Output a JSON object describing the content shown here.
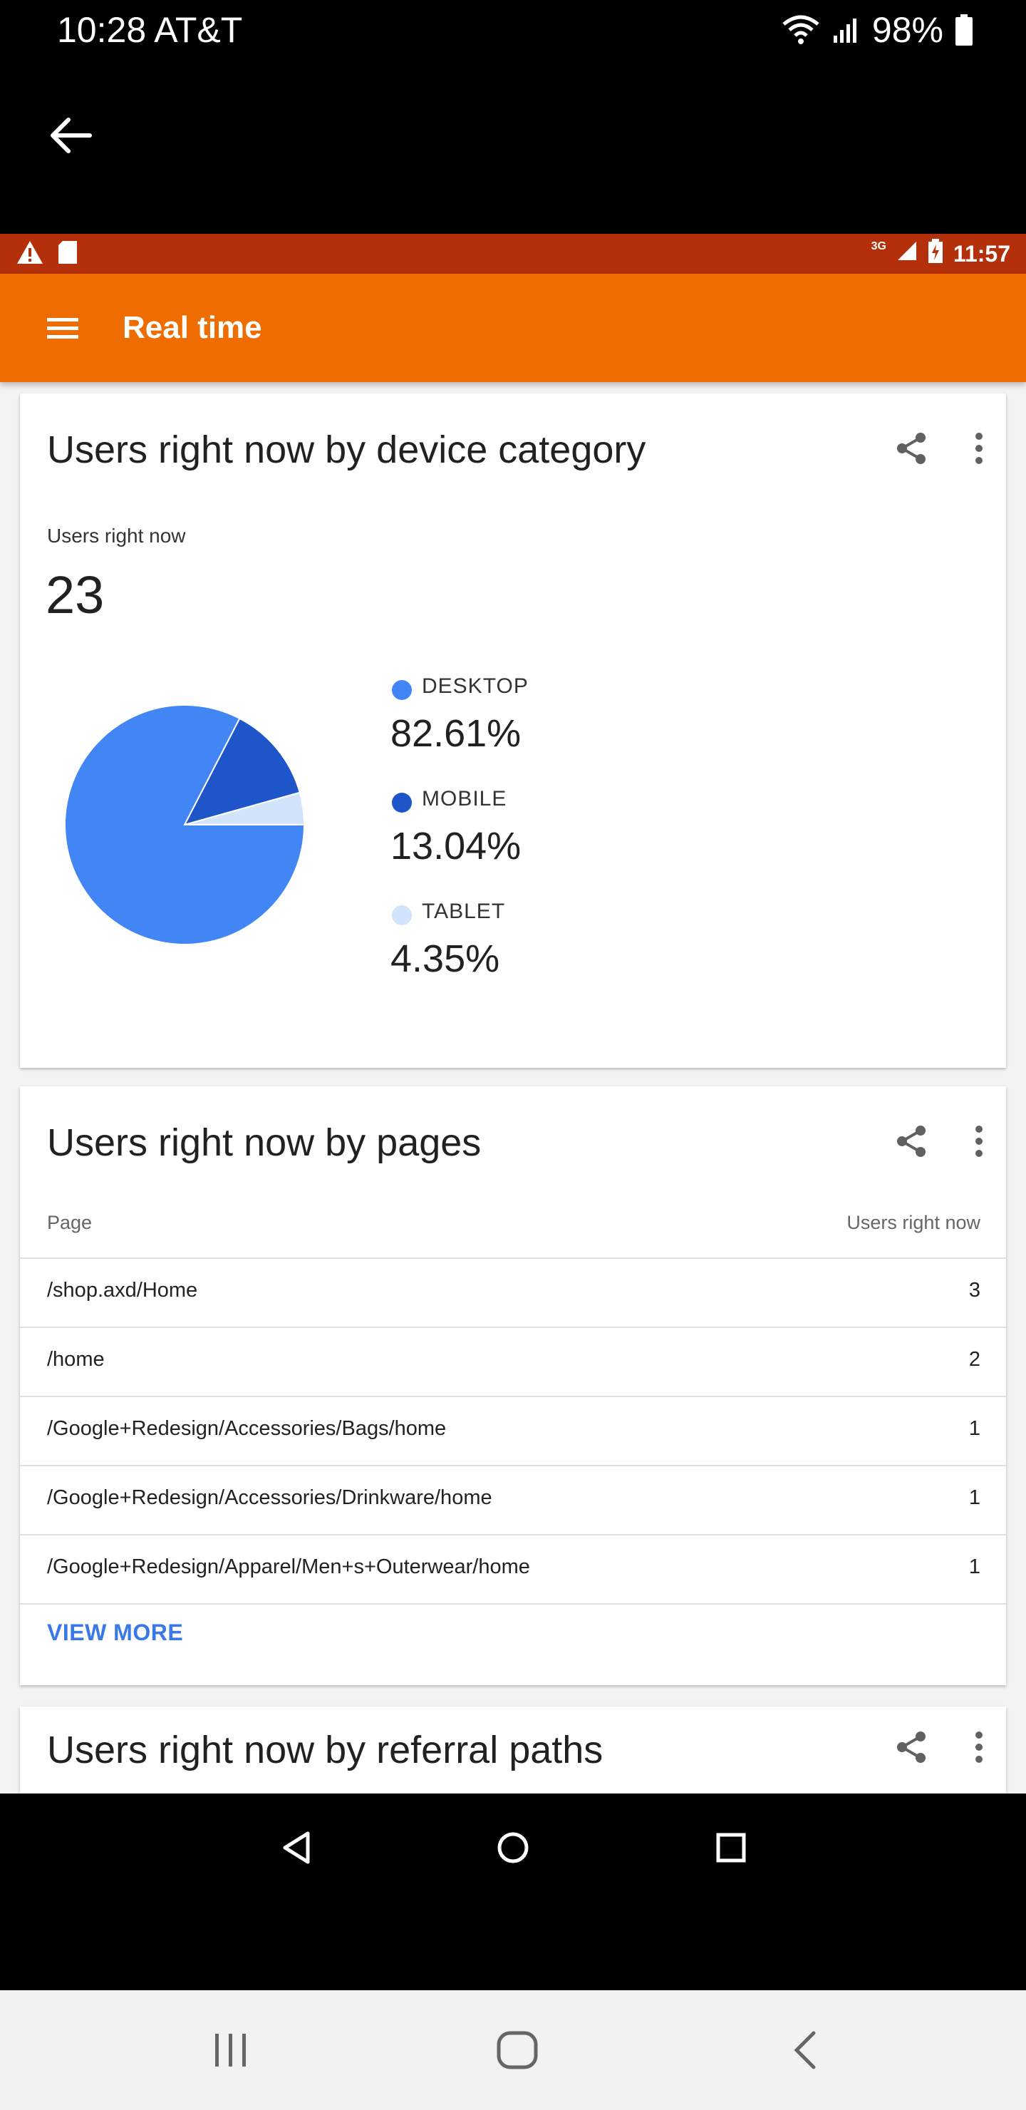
{
  "phone_status": {
    "time_carrier": "10:28 AT&T",
    "battery": "98%"
  },
  "inner_status": {
    "network": "3G",
    "time": "11:57"
  },
  "appbar": {
    "title": "Real time"
  },
  "device_card": {
    "title": "Users right now by device category",
    "metric_label": "Users right now",
    "metric_value": "23",
    "legend": [
      {
        "name": "DESKTOP",
        "value": "82.61%",
        "color": "#4285f4"
      },
      {
        "name": "MOBILE",
        "value": "13.04%",
        "color": "#1e55c8"
      },
      {
        "name": "TABLET",
        "value": "4.35%",
        "color": "#d2e3fc"
      }
    ]
  },
  "chart_data": {
    "type": "pie",
    "categories": [
      "DESKTOP",
      "MOBILE",
      "TABLET"
    ],
    "values": [
      82.61,
      13.04,
      4.35
    ],
    "colors": [
      "#4285f4",
      "#1e55c8",
      "#d2e3fc"
    ]
  },
  "pages_card": {
    "title": "Users right now by pages",
    "columns": [
      "Page",
      "Users right now"
    ],
    "rows": [
      {
        "page": "/shop.axd/Home",
        "users": "3"
      },
      {
        "page": "/home",
        "users": "2"
      },
      {
        "page": "/Google+Redesign/Accessories/Bags/home",
        "users": "1"
      },
      {
        "page": "/Google+Redesign/Accessories/Drinkware/home",
        "users": "1"
      },
      {
        "page": "/Google+Redesign/Apparel/Men+s+Outerwear/home",
        "users": "1"
      }
    ],
    "view_more": "VIEW MORE"
  },
  "referral_card": {
    "title": "Users right now by referral paths"
  },
  "icons": {
    "back": "arrow-left-icon",
    "menu": "hamburger-menu-icon",
    "share": "share-icon",
    "more": "more-vert-icon"
  },
  "colors": {
    "appbar": "#ef6c00",
    "inner_status": "#b4300a",
    "link": "#3b78e7"
  }
}
